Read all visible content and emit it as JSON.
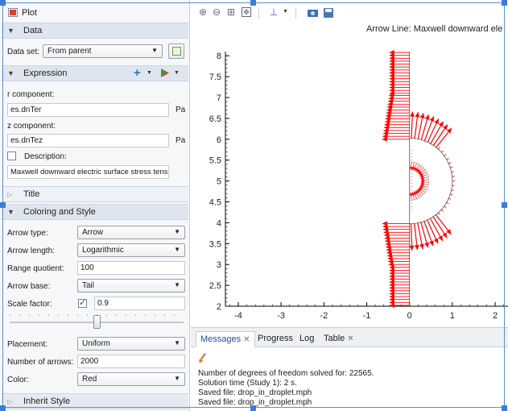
{
  "settings": {
    "window_title": "Plot",
    "data_section": {
      "title": "Data",
      "dataset_label": "Data set:",
      "dataset_value": "From parent"
    },
    "expression_section": {
      "title": "Expression",
      "r_label": "r component:",
      "r_value": "es.dnTer",
      "r_unit": "Pa",
      "z_label": "z component:",
      "z_value": "es.dnTez",
      "z_unit": "Pa",
      "description_label": "Description:",
      "description_checked": false,
      "description_value": "Maxwell downward electric surface stress tens"
    },
    "title_section": {
      "title": "Title"
    },
    "coloring_section": {
      "title": "Coloring and Style",
      "arrow_type_label": "Arrow type:",
      "arrow_type_value": "Arrow",
      "arrow_length_label": "Arrow length:",
      "arrow_length_value": "Logarithmic",
      "range_quotient_label": "Range quotient:",
      "range_quotient_value": "100",
      "arrow_base_label": "Arrow base:",
      "arrow_base_value": "Tail",
      "scale_factor_label": "Scale factor:",
      "scale_factor_checked": true,
      "scale_factor_value": "0.9",
      "slider_position": 0.5,
      "placement_label": "Placement:",
      "placement_value": "Uniform",
      "num_arrows_label": "Number of arrows:",
      "num_arrows_value": "2000",
      "color_label": "Color:",
      "color_value": "Red"
    },
    "inherit_section": {
      "title": "Inherit Style"
    }
  },
  "toolbar": {
    "icons": [
      "zoom-in-icon",
      "zoom-out-icon",
      "zoom-box-icon",
      "zoom-extents-icon",
      "axis-orientation-icon",
      "camera-icon",
      "print-icon"
    ]
  },
  "chart_data": {
    "type": "arrow",
    "title": "Arrow Line: Maxwell downward ele",
    "xlim": [
      -4.3,
      2.3
    ],
    "ylim": [
      2,
      8.1
    ],
    "x_ticks": [
      -4,
      -3,
      -2,
      -1,
      0,
      1,
      2
    ],
    "y_ticks": [
      2,
      2.5,
      3,
      3.5,
      4,
      4.5,
      5,
      5.5,
      6,
      6.5,
      7,
      7.5,
      8
    ],
    "arrow_color": "#ff0000",
    "droplet_center": [
      0,
      5
    ],
    "droplet_radius": 1.0
  },
  "messages": {
    "tabs": [
      "Messages",
      "Progress",
      "Log",
      "Table"
    ],
    "active_tab": "Messages",
    "lines": [
      "Number of degrees of freedom solved for: 22565.",
      "Solution time (Study 1): 2 s.",
      "Saved file: drop_in_droplet.mph",
      "Saved file: drop_in_droplet.mph"
    ]
  }
}
